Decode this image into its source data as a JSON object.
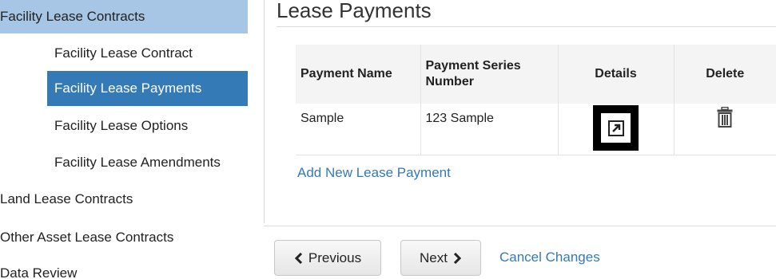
{
  "sidebar": {
    "items": [
      {
        "label": "Facility Lease Contracts"
      },
      {
        "label": "Facility Lease Contract"
      },
      {
        "label": "Facility Lease Payments"
      },
      {
        "label": "Facility Lease Options"
      },
      {
        "label": "Facility Lease Amendments"
      },
      {
        "label": "Land Lease Contracts"
      },
      {
        "label": "Other Asset Lease Contracts"
      },
      {
        "label": "Data Review"
      }
    ]
  },
  "main": {
    "title": "Lease Payments",
    "table": {
      "headers": [
        "Payment Name",
        "Payment Series Number",
        "Details",
        "Delete"
      ],
      "rows": [
        {
          "name": "Sample",
          "series": "123 Sample"
        }
      ]
    },
    "add_link": "Add New Lease Payment"
  },
  "footer": {
    "previous_label": "Previous",
    "next_label": "Next",
    "cancel_label": "Cancel Changes"
  },
  "colors": {
    "sidebar_section_bg": "#a7c6e5",
    "sidebar_active_bg": "#337ab7",
    "link": "#337ab7"
  },
  "icons": {
    "details": "external-link-icon",
    "delete": "trash-icon",
    "previous": "chevron-left-icon",
    "next": "chevron-right-icon"
  }
}
